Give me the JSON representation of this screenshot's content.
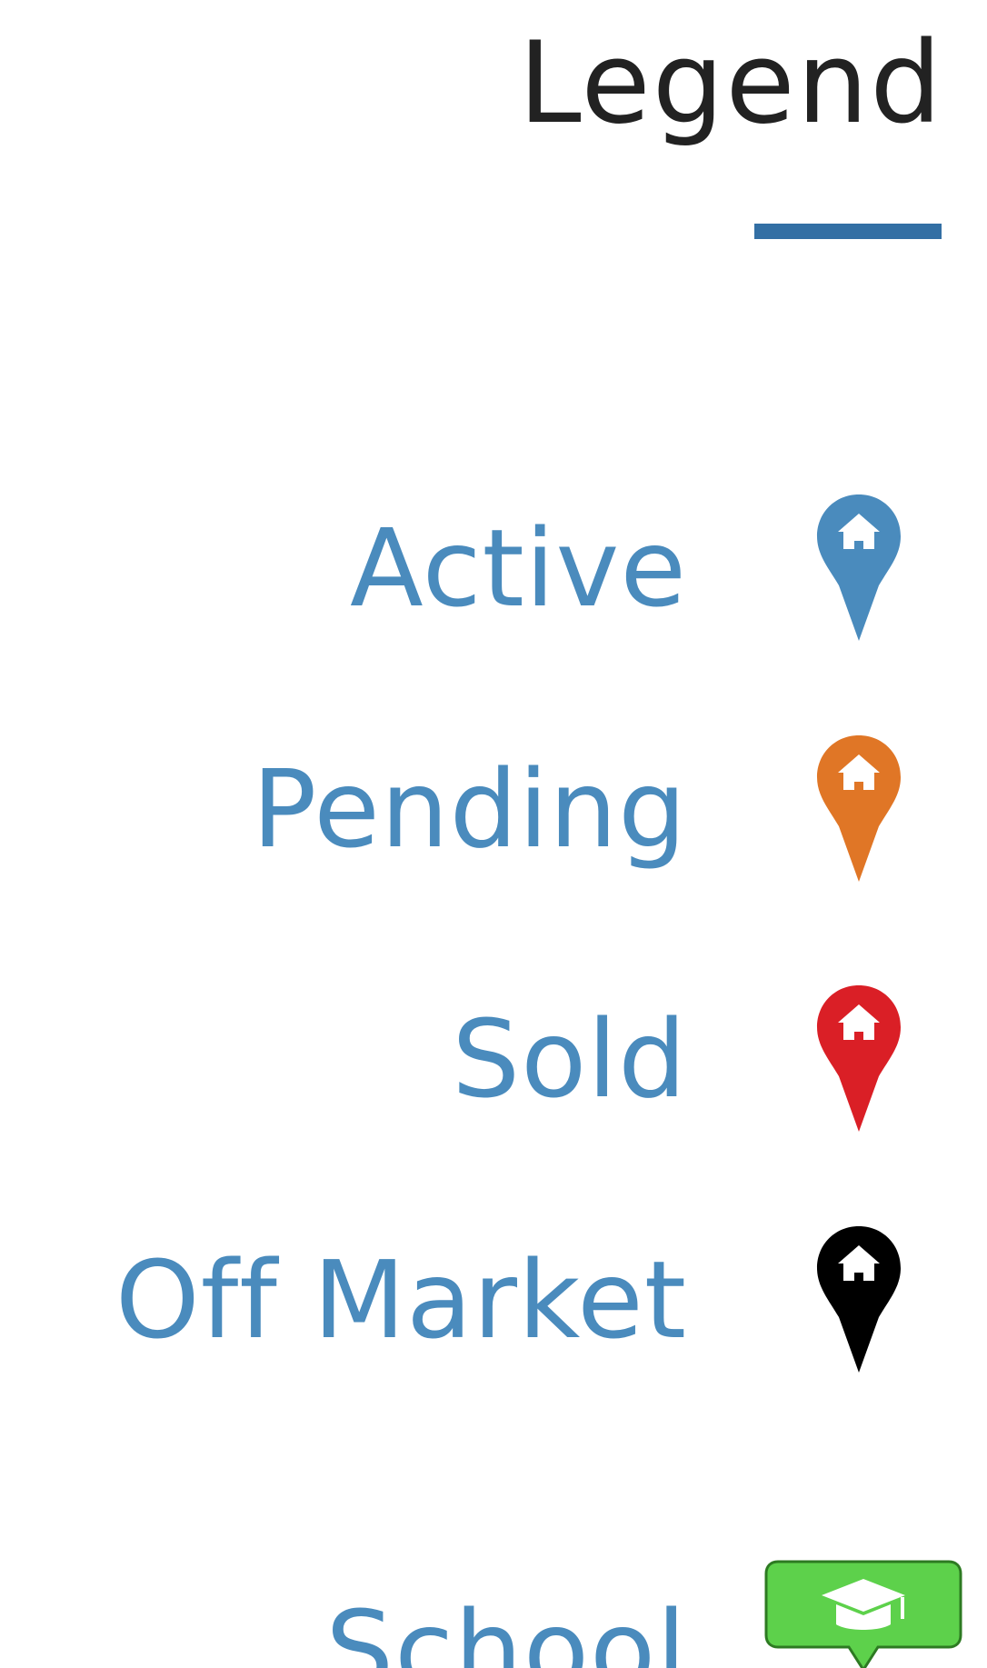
{
  "legend": {
    "title": "Legend",
    "accent_color": "#336fa4",
    "label_color": "#4a8bbd",
    "items": [
      {
        "label": "Active",
        "icon": "home-pin-icon",
        "color": "#4a8bbd"
      },
      {
        "label": "Pending",
        "icon": "home-pin-icon",
        "color": "#e07626"
      },
      {
        "label": "Sold",
        "icon": "home-pin-icon",
        "color": "#da1f26"
      },
      {
        "label": "Off Market",
        "icon": "home-pin-icon",
        "color": "#000000"
      },
      {
        "label": "School",
        "icon": "graduation-cap-icon",
        "color": "#5dd14b"
      }
    ]
  }
}
